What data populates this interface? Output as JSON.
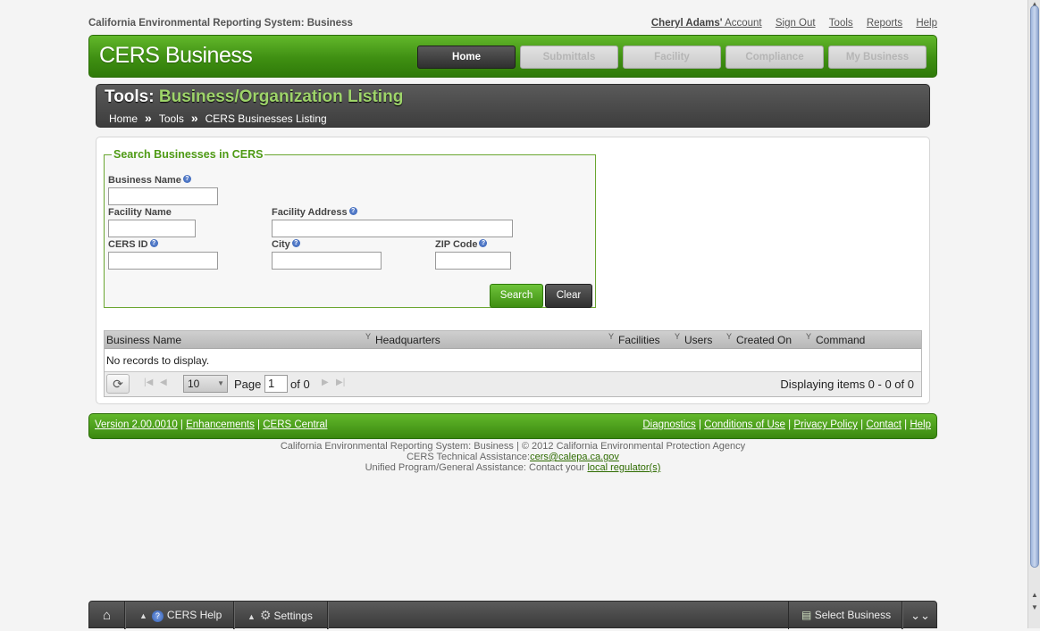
{
  "system_name": "California Environmental Reporting System: Business",
  "account": {
    "user": "Cheryl Adams'",
    "suffix": " Account"
  },
  "top_links": [
    "Sign Out",
    "Tools",
    "Reports",
    "Help"
  ],
  "brand": "CERS Business",
  "nav": [
    "Home",
    "Submittals",
    "Facility",
    "Compliance",
    "My Business"
  ],
  "page_title": {
    "prefix": "Tools:",
    "main": "Business/Organization Listing"
  },
  "breadcrumb": [
    "Home",
    "Tools",
    "CERS Businesses Listing"
  ],
  "breadcrumb_sep": "»",
  "search": {
    "legend": "Search Businesses in CERS",
    "business_name": "Business Name",
    "facility_name": "Facility Name",
    "facility_address": "Facility Address",
    "cers_id": "CERS ID",
    "city": "City",
    "zip": "ZIP Code",
    "search_btn": "Search",
    "clear_btn": "Clear"
  },
  "grid": {
    "columns": [
      "Business Name",
      "Headquarters",
      "Facilities",
      "Users",
      "Created On",
      "Command"
    ],
    "empty": "No records to display.",
    "page_size": "10",
    "page_label": "Page",
    "page_value": "1",
    "of_label": "of 0",
    "displaying": "Displaying items 0 - 0 of 0"
  },
  "footer": {
    "left": [
      "Version 2.00.0010",
      "Enhancements",
      "CERS Central"
    ],
    "right": [
      "Diagnostics",
      "Conditions of Use",
      "Privacy Policy",
      "Contact",
      "Help"
    ]
  },
  "copyright": {
    "line1": "California Environmental Reporting System: Business | © 2012 California Environmental Protection Agency",
    "line2_text": "CERS Technical Assistance:",
    "line2_link": "cers@calepa.ca.gov",
    "line3_text": "Unified Program/General Assistance: Contact your ",
    "line3_link": "local regulator(s)"
  },
  "bottom_bar": {
    "help": "CERS Help",
    "settings": "Settings",
    "select_business": "Select Business"
  }
}
